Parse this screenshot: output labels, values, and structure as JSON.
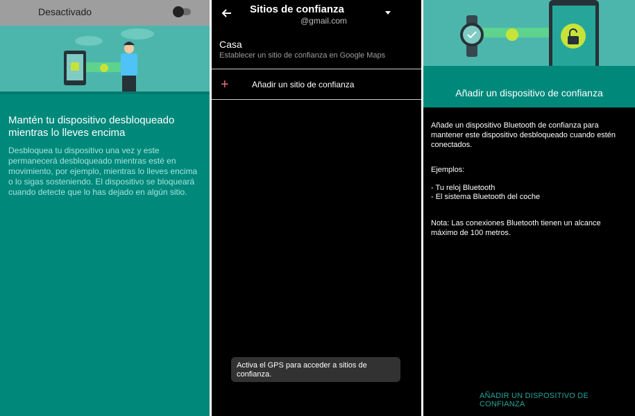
{
  "left_panel": {
    "toggle_label": "Desactivado",
    "title": "Mantén tu dispositivo desbloqueado mientras lo lleves encima",
    "body": "Desbloquea tu dispositivo una vez y este permanecerá desbloqueado mientras esté en movimiento, por ejemplo, mientras lo lleves encima o lo sigas sosteniendo. El dispositivo se bloqueará cuando detecte que lo has dejado en algún sitio.",
    "toggle_on": false
  },
  "middle_panel": {
    "title": "Sitios de confianza",
    "account": "@gmail.com",
    "place_name": "Casa",
    "place_hint": "Establecer un sitio de confianza en Google Maps",
    "add_place": "Añadir un sitio de confianza",
    "toast": "Activa el GPS para acceder a sitios de confianza."
  },
  "right_panel": {
    "title": "Añadir un dispositivo de confianza",
    "desc": "Añade un dispositivo Bluetooth de confianza para mantener este dispositivo desbloqueado cuando estén conectados.",
    "examples_label": "Ejemplos:",
    "example_1": "- Tu reloj Bluetooth",
    "example_2": "- El sistema Bluetooth del coche",
    "note": "Nota: Las conexiones Bluetooth tienen un alcance máximo de 100 metros.",
    "action": "AÑADIR UN DISPOSITIVO DE CONFIANZA"
  },
  "colors": {
    "teal": "#00897b",
    "teal_light": "#4db6ac",
    "accent_green": "#26a69a",
    "plus_red": "#e8707a"
  }
}
